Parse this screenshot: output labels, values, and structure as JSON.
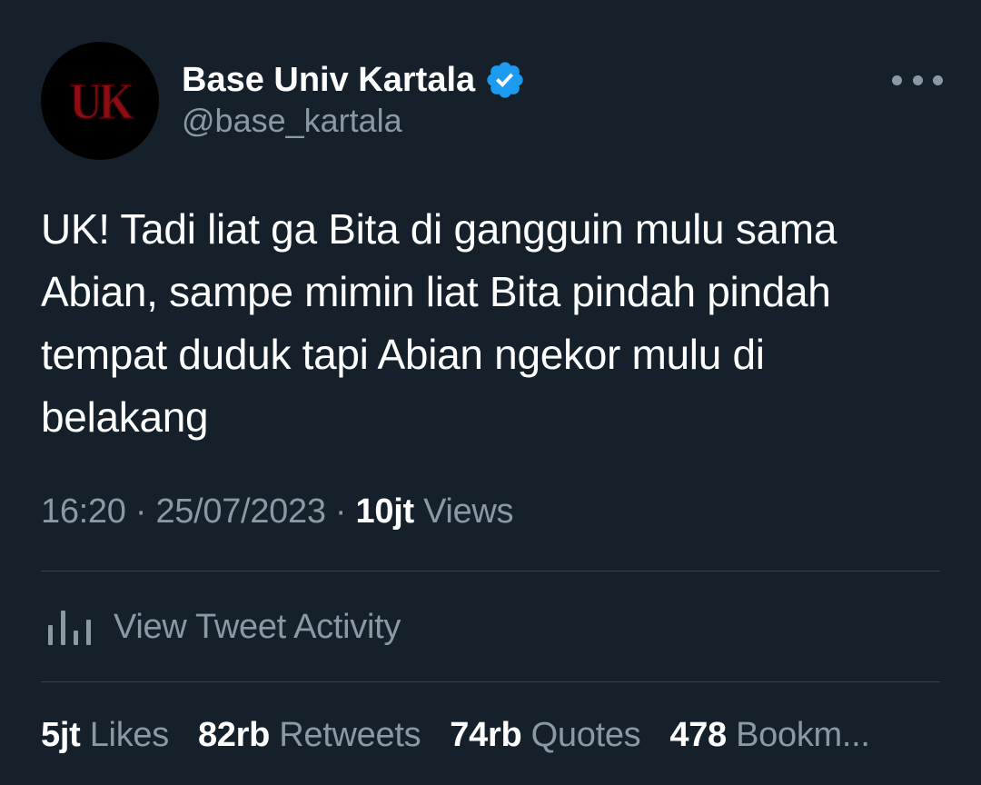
{
  "account": {
    "avatar_text": "UK",
    "display_name": "Base Univ Kartala",
    "handle": "@base_kartala"
  },
  "tweet": {
    "text": "UK! Tadi liat ga Bita di gangguin mulu sama Abian, sampe mimin liat Bita pindah pindah tempat duduk tapi Abian ngekor mulu di belakang",
    "time": "16:20",
    "separator1": " · ",
    "date": "25/07/2023",
    "separator2": " · ",
    "views_count": "10jt",
    "views_label": " Views"
  },
  "activity": {
    "label": "View Tweet Activity",
    "icon": "bar-chart-icon"
  },
  "stats": {
    "likes_count": "5jt",
    "likes_label": "Likes",
    "retweets_count": "82rb",
    "retweets_label": "Retweets",
    "quotes_count": "74rb",
    "quotes_label": "Quotes",
    "bookmarks_count": "478",
    "bookmarks_label": "Bookm..."
  },
  "colors": {
    "background": "#15202b",
    "primary_text": "#ffffff",
    "secondary_text": "#8b98a5",
    "verified_blue": "#1d9bf0",
    "divider": "#38444d",
    "avatar_logo": "#8b0d12"
  },
  "icons": {
    "verified": "verified-badge-icon",
    "more": "more-options-icon",
    "activity": "bar-chart-icon"
  }
}
